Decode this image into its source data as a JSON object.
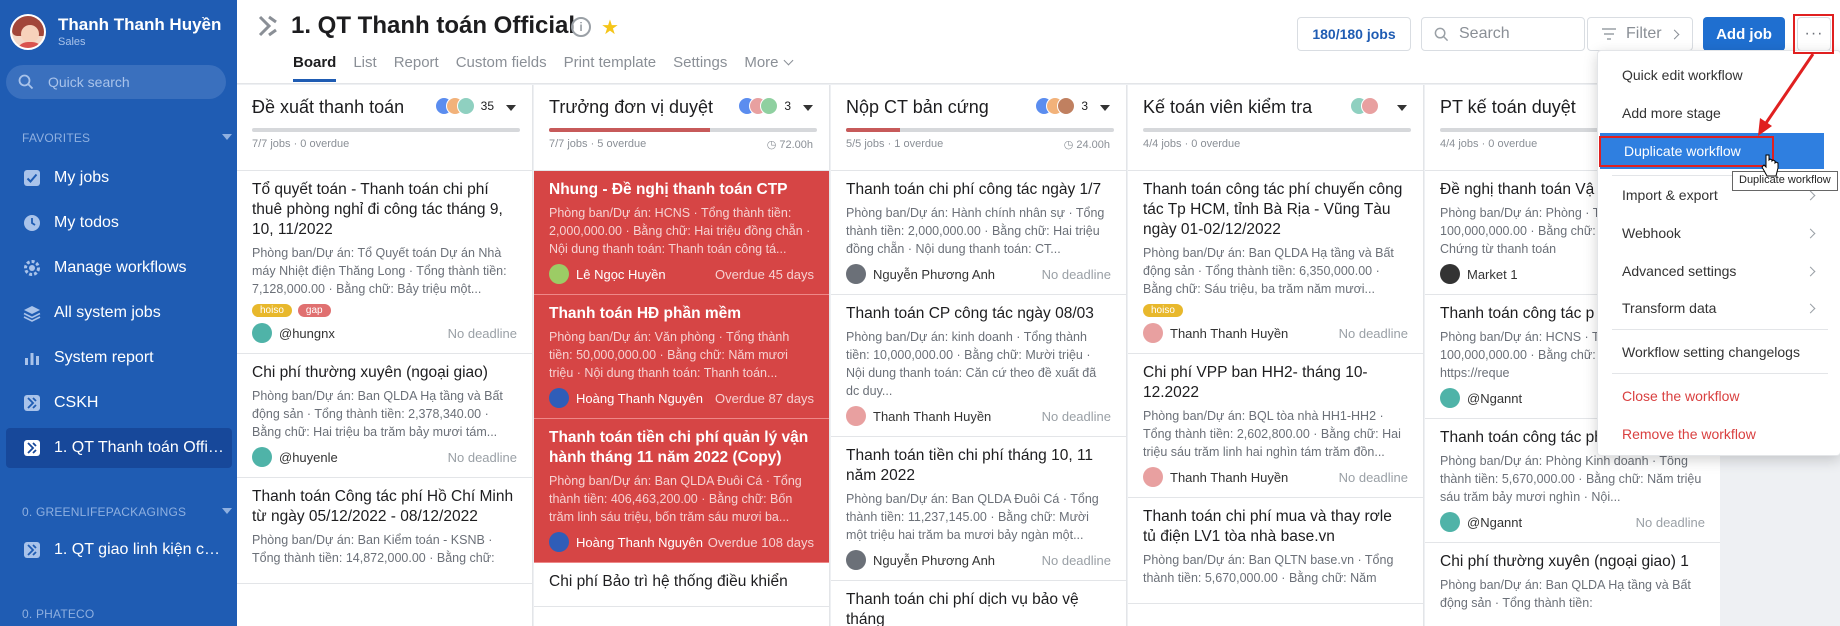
{
  "user": {
    "name": "Thanh Thanh Huyền",
    "role": "Sales"
  },
  "sidebar": {
    "quick_search_placeholder": "Quick search",
    "favorites_label": "FAVORITES",
    "items": [
      {
        "label": "My jobs",
        "icon": "check-square-icon"
      },
      {
        "label": "My todos",
        "icon": "clock-icon"
      },
      {
        "label": "Manage workflows",
        "icon": "gear-icon"
      },
      {
        "label": "All system jobs",
        "icon": "layers-icon"
      },
      {
        "label": "System report",
        "icon": "bar-chart-icon"
      },
      {
        "label": "CSKH",
        "icon": "workflow-icon"
      },
      {
        "label": "1. QT Thanh toán Official",
        "icon": "workflow-icon",
        "active": true
      }
    ],
    "section2_label": "0. GREENLIFEPACKAGINGS",
    "section2_items": [
      {
        "label": "1. QT giao linh kiện cho khách",
        "icon": "workflow-icon"
      }
    ],
    "section3_label": "0. PHATECO"
  },
  "header": {
    "title": "1. QT Thanh toán Official",
    "tabs": [
      "Board",
      "List",
      "Report",
      "Custom fields",
      "Print template",
      "Settings",
      "More"
    ],
    "jobs_count": "180/180 jobs",
    "search_placeholder": "Search",
    "filter_label": "Filter",
    "add_job_label": "Add job",
    "more_label": "···"
  },
  "columns": [
    {
      "title": "Đề xuất thanh toán",
      "count": "35",
      "stat": "7/7 jobs · 0 overdue",
      "time": "",
      "progress": 0,
      "cards": [
        {
          "title": "Tổ quyết toán - Thanh toán chi phí thuê phòng nghỉ đi công tác tháng 9, 10, 11/2022",
          "desc": "Phòng ban/Dự án: Tổ Quyết toán Dự án Nhà máy Nhiệt điện Thăng Long · Tổng thành tiền: 7,128,000.00 · Bằng chữ: Bảy triệu một...",
          "tags": [
            "hoiso",
            "gap"
          ],
          "user": "@hungnx",
          "deadline": "No deadline",
          "red": false
        },
        {
          "title": "Chi phí thường xuyên (ngoại giao)",
          "desc": "Phòng ban/Dự án: Ban QLDA Hạ tầng và Bất động sản · Tổng thành tiền: 2,378,340.00 · Bằng chữ: Hai triệu ba trăm bảy mươi tám...",
          "tags": [],
          "user": "@huyenle",
          "deadline": "No deadline",
          "red": false
        },
        {
          "title": "Thanh toán Công tác phí Hồ Chí Minh từ ngày 05/12/2022 - 08/12/2022",
          "desc": "Phòng ban/Dự án: Ban Kiểm toán - KSNB · Tổng thành tiền: 14,872,000.00 · Bằng chữ:",
          "tags": [],
          "user": "",
          "deadline": "",
          "red": false
        }
      ]
    },
    {
      "title": "Trưởng đơn vị duyệt",
      "count": "3",
      "stat": "7/7 jobs · 5 overdue",
      "time": "72.00h",
      "progress": 0.6,
      "cards": [
        {
          "title": "Nhung - Đề nghị thanh toán CTP",
          "desc": "Phòng ban/Dự án: HCNS · Tổng thành tiền: 2,000,000.00 · Bằng chữ: Hai triệu đồng chẵn · Nội dung thanh toán: Thanh toán công tá...",
          "tags": [],
          "user": "Lê Ngọc Huyền",
          "deadline": "Overdue 45 days",
          "red": true
        },
        {
          "title": "Thanh toán HĐ phần mềm",
          "desc": "Phòng ban/Dự án: Văn phòng · Tổng thành tiền: 50,000,000.00 · Bằng chữ: Năm mươi triệu · Nội dung thanh toán: Thanh toán...",
          "tags": [],
          "user": "Hoàng Thanh Nguyên",
          "deadline": "Overdue 87 days",
          "red": true
        },
        {
          "title": "Thanh toán tiền chi phí quản lý vận hành tháng 11 năm 2022 (Copy)",
          "desc": "Phòng ban/Dự án: Ban QLDA Đuôi Cá · Tổng thành tiền: 406,463,200.00 · Bằng chữ: Bốn trăm linh sáu triệu, bốn trăm sáu mươi ba...",
          "tags": [],
          "user": "Hoàng Thanh Nguyên",
          "deadline": "Overdue 108 days",
          "red": true
        },
        {
          "title": "Chi phí Bảo trì hệ thống điều khiển",
          "desc": "",
          "tags": [],
          "user": "",
          "deadline": "",
          "red": false
        }
      ]
    },
    {
      "title": "Nộp CT bản cứng",
      "count": "3",
      "stat": "5/5 jobs · 1 overdue",
      "time": "24.00h",
      "progress": 0.2,
      "cards": [
        {
          "title": "Thanh toán chi phí công tác ngày 1/7",
          "desc": "Phòng ban/Dự án: Hành chính nhân sự · Tổng thành tiền: 2,000,000.00 · Bằng chữ: Hai triệu đồng chẵn · Nội dung thanh toán: CT...",
          "tags": [],
          "user": "Nguyễn Phương Anh",
          "deadline": "No deadline",
          "red": false
        },
        {
          "title": "Thanh toán CP công tác ngày 08/03",
          "desc": "Phòng ban/Dự án: kinh doanh · Tổng thành tiền: 10,000,000.00 · Bằng chữ: Mười triệu · Nội dung thanh toán: Căn cứ theo đề xuất đã dc duy...",
          "tags": [],
          "user": "Thanh Thanh Huyền",
          "deadline": "No deadline",
          "red": false
        },
        {
          "title": "Thanh toán tiền chi phí tháng 10, 11 năm 2022",
          "desc": "Phòng ban/Dự án: Ban QLDA Đuôi Cá · Tổng thành tiền: 11,237,145.00 · Bằng chữ: Mười một triệu hai trăm ba mươi bảy ngàn một...",
          "tags": [],
          "user": "Nguyễn Phương Anh",
          "deadline": "No deadline",
          "red": false
        },
        {
          "title": "Thanh toán chi phí dịch vụ bảo vệ tháng",
          "desc": "",
          "tags": [],
          "user": "",
          "deadline": "",
          "red": false
        }
      ]
    },
    {
      "title": "Kế toán viên kiểm tra",
      "count": "",
      "stat": "4/4 jobs · 0 overdue",
      "time": "",
      "progress": 0,
      "cards": [
        {
          "title": "Thanh toán công tác phí chuyến công tác Tp HCM, tỉnh Bà Rịa - Vũng Tàu ngày 01-02/12/2022",
          "desc": "Phòng ban/Dự án: Ban QLDA Hạ tầng và Bất động sản · Tổng thành tiền: 6,350,000.00 · Bằng chữ: Sáu triệu, ba trăm năm mươi...",
          "tags": [
            "hoiso"
          ],
          "user": "Thanh Thanh Huyền",
          "deadline": "No deadline",
          "red": false
        },
        {
          "title": "Chi phí VPP ban HH2- tháng 10-12.2022",
          "desc": "Phòng ban/Dự án: BQL tòa nhà HH1-HH2 · Tổng thành tiền: 2,602,800.00 · Bằng chữ: Hai triệu sáu trăm linh hai nghìn tám trăm đồn...",
          "tags": [],
          "user": "Thanh Thanh Huyền",
          "deadline": "No deadline",
          "red": false
        },
        {
          "title": "Thanh toán chi phí mua và thay rơle tủ điện LV1 tòa nhà base.vn",
          "desc": "Phòng ban/Dự án: Ban QLTN base.vn · Tổng thành tiền: 5,670,000.00 · Bằng chữ: Năm",
          "tags": [],
          "user": "",
          "deadline": "",
          "red": false
        }
      ]
    },
    {
      "title": "PT kế toán duyệt",
      "count": "",
      "stat": "4/4 jobs · 0 overdue",
      "time": "",
      "progress": 0,
      "cards": [
        {
          "title": "Đề nghị thanh toán Vậ",
          "desc": "Phòng ban/Dự án: Phòng · Tổng thành tiền: 100,000,000.00 · Bằng chữ: Một trăm triệu · Chứng từ thanh toán",
          "tags": [],
          "user": "Market 1",
          "deadline": "",
          "red": false
        },
        {
          "title": "Thanh toán công tác p",
          "desc": "Phòng ban/Dự án: HCNS · Tổng thành tiền: 100,000,000.00 · Bằng chữ: theo đề xuất: https://reque",
          "tags": [],
          "user": "@Ngannt",
          "deadline": "",
          "red": false
        },
        {
          "title": "Thanh toán công tác phí",
          "desc": "Phòng ban/Dự án: Phòng Kinh doanh · Tổng thành tiền: 5,670,000.00 · Bằng chữ: Năm triệu sáu trăm bảy mươi nghìn · Nội...",
          "tags": [],
          "user": "@Ngannt",
          "deadline": "No deadline",
          "red": false
        },
        {
          "title": "Chi phí thường xuyên (ngoại giao) 1",
          "desc": "Phòng ban/Dự án: Ban QLDA Hạ tầng và Bất động sản · Tổng thành tiền:",
          "tags": [],
          "user": "",
          "deadline": "",
          "red": false
        }
      ]
    }
  ],
  "menu": {
    "items": [
      {
        "label": "Quick edit workflow",
        "type": "normal"
      },
      {
        "label": "Add more stage",
        "type": "normal"
      },
      {
        "label": "Duplicate workflow",
        "type": "highlight"
      },
      {
        "label": "Import & export",
        "type": "submenu"
      },
      {
        "label": "Webhook",
        "type": "submenu"
      },
      {
        "label": "Advanced settings",
        "type": "submenu"
      },
      {
        "label": "Transform data",
        "type": "submenu"
      },
      {
        "label": "Workflow setting changelogs",
        "type": "normal"
      },
      {
        "label": "Close the workflow",
        "type": "danger"
      },
      {
        "label": "Remove the workflow",
        "type": "danger"
      }
    ],
    "tooltip": "Duplicate workflow"
  },
  "colors": {
    "sidebar": "#1f5cb3",
    "accent": "#1f6fd0",
    "overdue_card": "#d64545",
    "annotation": "#e02020",
    "tag_hoiso": "#e8b82c",
    "tag_gap": "#e07070"
  }
}
